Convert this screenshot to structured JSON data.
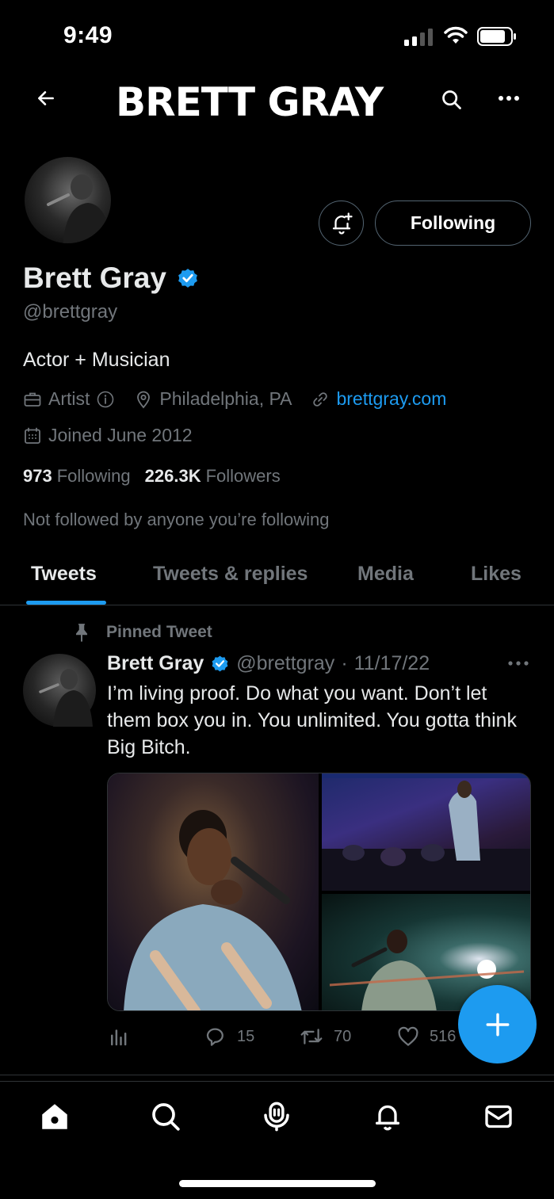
{
  "status_bar": {
    "time": "9:49"
  },
  "header": {
    "banner_text": "BRETT GRAY"
  },
  "profile": {
    "following_button_label": "Following",
    "display_name": "Brett Gray",
    "handle": "@brettgray",
    "bio": "Actor + Musician",
    "category": "Artist",
    "location": "Philadelphia, PA",
    "website": "brettgray.com",
    "joined": "Joined June 2012",
    "following_count": "973",
    "following_label": "Following",
    "followers_count": "226.3K",
    "followers_label": "Followers",
    "not_followed_note": "Not followed by anyone you’re following"
  },
  "tabs": [
    {
      "label": "Tweets",
      "active": true
    },
    {
      "label": "Tweets & replies",
      "active": false
    },
    {
      "label": "Media",
      "active": false
    },
    {
      "label": "Likes",
      "active": false
    }
  ],
  "pinned_tweet": {
    "pinned_label": "Pinned Tweet",
    "author_name": "Brett Gray",
    "author_handle": "@brettgray",
    "date_sep": "·",
    "date": "11/17/22",
    "text": "I’m living proof. Do what you want. Don’t let them box you in. You unlimited. You gotta think Big Bitch.",
    "replies": "15",
    "retweets": "70",
    "likes": "516"
  },
  "colors": {
    "accent": "#1d9bf0",
    "background": "#000000",
    "muted": "#71767b"
  },
  "icons": {
    "back": "arrow-left-icon",
    "search": "search-icon",
    "more": "more-horizontal-icon",
    "bell": "notification-bell-plus-icon",
    "verified": "verified-badge-icon",
    "briefcase": "briefcase-icon",
    "info": "info-icon",
    "location": "location-pin-icon",
    "link": "link-icon",
    "calendar": "calendar-icon",
    "pin": "pin-icon",
    "analytics": "analytics-icon",
    "reply": "reply-icon",
    "retweet": "retweet-icon",
    "like": "heart-icon",
    "compose": "plus-icon",
    "nav_home": "home-icon",
    "nav_search": "search-icon",
    "nav_spaces": "spaces-icon",
    "nav_notifications": "bell-icon",
    "nav_messages": "mail-icon"
  }
}
